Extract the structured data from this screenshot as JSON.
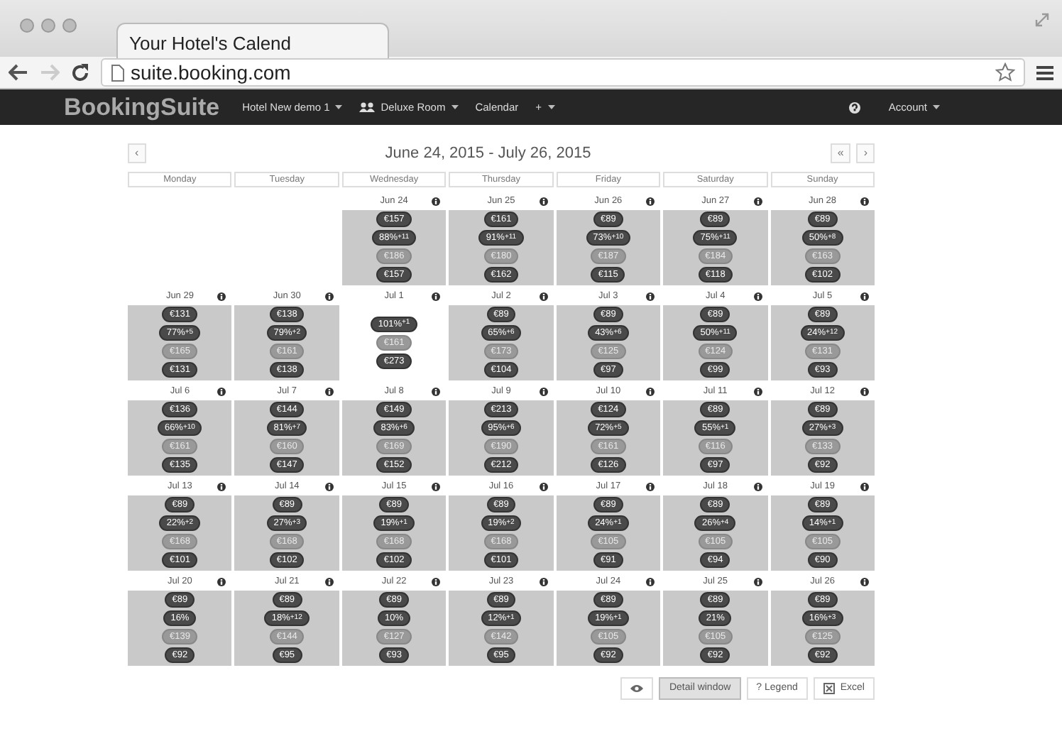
{
  "browser": {
    "tab_title": "Your Hotel's Calend",
    "url": "suite.booking.com"
  },
  "navbar": {
    "brand": "Booking**Suite**",
    "items": [
      {
        "label": "Hotel New demo 1",
        "kind": "plain",
        "dropdown": true
      },
      {
        "label": "Deluxe Room",
        "kind": "room",
        "dropdown": true
      },
      {
        "label": "Calendar",
        "kind": "plain",
        "dropdown": false
      },
      {
        "label": "+",
        "kind": "plain",
        "dropdown": true
      }
    ],
    "account": {
      "label": "Account",
      "dropdown": true
    }
  },
  "calendar": {
    "range": "June 24, 2015 - July 26, 2015",
    "prev": "‹",
    "next": [
      "«",
      "›"
    ],
    "weekdays": [
      "Monday",
      "Tuesday",
      "Wednesday",
      "Thursday",
      "Friday",
      "Saturday",
      "Sunday"
    ],
    "weeks": [
      [
        {
          "kind": "blank"
        },
        {
          "kind": "blank"
        },
        {
          "kind": "day",
          "date": "Jun 24",
          "shaded": true,
          "badges": [
            {
              "text": "€157",
              "muted": false
            },
            {
              "text": "88%$^{+11}$",
              "muted": false
            },
            {
              "text": "€186",
              "muted": true
            },
            {
              "text": "€157",
              "muted": false
            }
          ]
        },
        {
          "kind": "day",
          "date": "Jun 25",
          "shaded": true,
          "badges": [
            {
              "text": "€161",
              "muted": false
            },
            {
              "text": "91%$^{+11}$",
              "muted": false
            },
            {
              "text": "€180",
              "muted": true
            },
            {
              "text": "€162",
              "muted": false
            }
          ]
        },
        {
          "kind": "day",
          "date": "Jun 26",
          "shaded": true,
          "badges": [
            {
              "text": "€89",
              "muted": false
            },
            {
              "text": "73%$^{+10}$",
              "muted": false
            },
            {
              "text": "€187",
              "muted": true
            },
            {
              "text": "€115",
              "muted": false
            }
          ]
        },
        {
          "kind": "day",
          "date": "Jun 27",
          "shaded": true,
          "badges": [
            {
              "text": "€89",
              "muted": false
            },
            {
              "text": "75%$^{+11}$",
              "muted": false
            },
            {
              "text": "€184",
              "muted": true
            },
            {
              "text": "€118",
              "muted": false
            }
          ]
        },
        {
          "kind": "day",
          "date": "Jun 28",
          "shaded": true,
          "badges": [
            {
              "text": "€89",
              "muted": false
            },
            {
              "text": "50%$^{+8}$",
              "muted": false
            },
            {
              "text": "€163",
              "muted": true
            },
            {
              "text": "€102",
              "muted": false
            }
          ]
        }
      ],
      [
        {
          "kind": "day",
          "date": "Jun 29",
          "shaded": true,
          "badges": [
            {
              "text": "€131",
              "muted": false
            },
            {
              "text": "77%$^{+5}$",
              "muted": false
            },
            {
              "text": "€165",
              "muted": true
            },
            {
              "text": "€131",
              "muted": false
            }
          ]
        },
        {
          "kind": "day",
          "date": "Jun 30",
          "shaded": true,
          "badges": [
            {
              "text": "€138",
              "muted": false
            },
            {
              "text": "79%$^{+2}$",
              "muted": false
            },
            {
              "text": "€161",
              "muted": true
            },
            {
              "text": "€138",
              "muted": false
            }
          ]
        },
        {
          "kind": "day",
          "date": "Jul 1",
          "shaded": false,
          "badges": [
            {
              "text": "101%$^{+1}$",
              "muted": false
            },
            {
              "text": "€161",
              "muted": true
            },
            {
              "text": "€273",
              "muted": false
            }
          ]
        },
        {
          "kind": "day",
          "date": "Jul 2",
          "shaded": true,
          "badges": [
            {
              "text": "€89",
              "muted": false
            },
            {
              "text": "65%$^{+6}$",
              "muted": false
            },
            {
              "text": "€173",
              "muted": true
            },
            {
              "text": "€104",
              "muted": false
            }
          ]
        },
        {
          "kind": "day",
          "date": "Jul 3",
          "shaded": true,
          "badges": [
            {
              "text": "€89",
              "muted": false
            },
            {
              "text": "43%$^{+6}$",
              "muted": false
            },
            {
              "text": "€125",
              "muted": true
            },
            {
              "text": "€97",
              "muted": false
            }
          ]
        },
        {
          "kind": "day",
          "date": "Jul 4",
          "shaded": true,
          "badges": [
            {
              "text": "€89",
              "muted": false
            },
            {
              "text": "50%$^{+11}$",
              "muted": false
            },
            {
              "text": "€124",
              "muted": true
            },
            {
              "text": "€99",
              "muted": false
            }
          ]
        },
        {
          "kind": "day",
          "date": "Jul 5",
          "shaded": true,
          "badges": [
            {
              "text": "€89",
              "muted": false
            },
            {
              "text": "24%$^{+12}$",
              "muted": false
            },
            {
              "text": "€131",
              "muted": true
            },
            {
              "text": "€93",
              "muted": false
            }
          ]
        }
      ],
      [
        {
          "kind": "day",
          "date": "Jul 6",
          "shaded": true,
          "badges": [
            {
              "text": "€136",
              "muted": false
            },
            {
              "text": "66%$^{+10}$",
              "muted": false
            },
            {
              "text": "€161",
              "muted": true
            },
            {
              "text": "€135",
              "muted": false
            }
          ]
        },
        {
          "kind": "day",
          "date": "Jul 7",
          "shaded": true,
          "badges": [
            {
              "text": "€144",
              "muted": false
            },
            {
              "text": "81%$^{+7}$",
              "muted": false
            },
            {
              "text": "€160",
              "muted": true
            },
            {
              "text": "€147",
              "muted": false
            }
          ]
        },
        {
          "kind": "day",
          "date": "Jul 8",
          "shaded": true,
          "badges": [
            {
              "text": "€149",
              "muted": false
            },
            {
              "text": "83%$^{+6}$",
              "muted": false
            },
            {
              "text": "€169",
              "muted": true
            },
            {
              "text": "€152",
              "muted": false
            }
          ]
        },
        {
          "kind": "day",
          "date": "Jul 9",
          "shaded": true,
          "badges": [
            {
              "text": "€213",
              "muted": false
            },
            {
              "text": "95%$^{+6}$",
              "muted": false
            },
            {
              "text": "€190",
              "muted": true
            },
            {
              "text": "€212",
              "muted": false
            }
          ]
        },
        {
          "kind": "day",
          "date": "Jul 10",
          "shaded": true,
          "badges": [
            {
              "text": "€124",
              "muted": false
            },
            {
              "text": "72%$^{+5}$",
              "muted": false
            },
            {
              "text": "€161",
              "muted": true
            },
            {
              "text": "€126",
              "muted": false
            }
          ]
        },
        {
          "kind": "day",
          "date": "Jul 11",
          "shaded": true,
          "badges": [
            {
              "text": "€89",
              "muted": false
            },
            {
              "text": "55%$^{+1}$",
              "muted": false
            },
            {
              "text": "€116",
              "muted": true
            },
            {
              "text": "€97",
              "muted": false
            }
          ]
        },
        {
          "kind": "day",
          "date": "Jul 12",
          "shaded": true,
          "badges": [
            {
              "text": "€89",
              "muted": false
            },
            {
              "text": "27%$^{+3}$",
              "muted": false
            },
            {
              "text": "€133",
              "muted": true
            },
            {
              "text": "€92",
              "muted": false
            }
          ]
        }
      ],
      [
        {
          "kind": "day",
          "date": "Jul 13",
          "shaded": true,
          "badges": [
            {
              "text": "€89",
              "muted": false
            },
            {
              "text": "22%$^{+2}$",
              "muted": false
            },
            {
              "text": "€168",
              "muted": true
            },
            {
              "text": "€101",
              "muted": false
            }
          ]
        },
        {
          "kind": "day",
          "date": "Jul 14",
          "shaded": true,
          "badges": [
            {
              "text": "€89",
              "muted": false
            },
            {
              "text": "27%$^{+3}$",
              "muted": false
            },
            {
              "text": "€168",
              "muted": true
            },
            {
              "text": "€102",
              "muted": false
            }
          ]
        },
        {
          "kind": "day",
          "date": "Jul 15",
          "shaded": true,
          "badges": [
            {
              "text": "€89",
              "muted": false
            },
            {
              "text": "19%$^{+1}$",
              "muted": false
            },
            {
              "text": "€168",
              "muted": true
            },
            {
              "text": "€102",
              "muted": false
            }
          ]
        },
        {
          "kind": "day",
          "date": "Jul 16",
          "shaded": true,
          "badges": [
            {
              "text": "€89",
              "muted": false
            },
            {
              "text": "19%$^{+2}$",
              "muted": false
            },
            {
              "text": "€168",
              "muted": true
            },
            {
              "text": "€101",
              "muted": false
            }
          ]
        },
        {
          "kind": "day",
          "date": "Jul 17",
          "shaded": true,
          "badges": [
            {
              "text": "€89",
              "muted": false
            },
            {
              "text": "24%$^{+1}$",
              "muted": false
            },
            {
              "text": "€105",
              "muted": true
            },
            {
              "text": "€91",
              "muted": false
            }
          ]
        },
        {
          "kind": "day",
          "date": "Jul 18",
          "shaded": true,
          "badges": [
            {
              "text": "€89",
              "muted": false
            },
            {
              "text": "26%$^{+4}$",
              "muted": false
            },
            {
              "text": "€105",
              "muted": true
            },
            {
              "text": "€94",
              "muted": false
            }
          ]
        },
        {
          "kind": "day",
          "date": "Jul 19",
          "shaded": true,
          "badges": [
            {
              "text": "€89",
              "muted": false
            },
            {
              "text": "14%$^{+1}$",
              "muted": false
            },
            {
              "text": "€105",
              "muted": true
            },
            {
              "text": "€90",
              "muted": false
            }
          ]
        }
      ],
      [
        {
          "kind": "day",
          "date": "Jul 20",
          "shaded": true,
          "badges": [
            {
              "text": "€89",
              "muted": false
            },
            {
              "text": "16%",
              "muted": false
            },
            {
              "text": "€139",
              "muted": true
            },
            {
              "text": "€92",
              "muted": false
            }
          ]
        },
        {
          "kind": "day",
          "date": "Jul 21",
          "shaded": true,
          "badges": [
            {
              "text": "€89",
              "muted": false
            },
            {
              "text": "18%$^{+12}$",
              "muted": false
            },
            {
              "text": "€144",
              "muted": true
            },
            {
              "text": "€95",
              "muted": false
            }
          ]
        },
        {
          "kind": "day",
          "date": "Jul 22",
          "shaded": true,
          "badges": [
            {
              "text": "€89",
              "muted": false
            },
            {
              "text": "10%",
              "muted": false
            },
            {
              "text": "€127",
              "muted": true
            },
            {
              "text": "€93",
              "muted": false
            }
          ]
        },
        {
          "kind": "day",
          "date": "Jul 23",
          "shaded": true,
          "badges": [
            {
              "text": "€89",
              "muted": false
            },
            {
              "text": "12%$^{+1}$",
              "muted": false
            },
            {
              "text": "€142",
              "muted": true
            },
            {
              "text": "€95",
              "muted": false
            }
          ]
        },
        {
          "kind": "day",
          "date": "Jul 24",
          "shaded": true,
          "badges": [
            {
              "text": "€89",
              "muted": false
            },
            {
              "text": "19%$^{+1}$",
              "muted": false
            },
            {
              "text": "€105",
              "muted": true
            },
            {
              "text": "€92",
              "muted": false
            }
          ]
        },
        {
          "kind": "day",
          "date": "Jul 25",
          "shaded": true,
          "badges": [
            {
              "text": "€89",
              "muted": false
            },
            {
              "text": "21%",
              "muted": false
            },
            {
              "text": "€105",
              "muted": true
            },
            {
              "text": "€92",
              "muted": false
            }
          ]
        },
        {
          "kind": "day",
          "date": "Jul 26",
          "shaded": true,
          "badges": [
            {
              "text": "€89",
              "muted": false
            },
            {
              "text": "16%$^{+3}$",
              "muted": false
            },
            {
              "text": "€125",
              "muted": true
            },
            {
              "text": "€92",
              "muted": false
            }
          ]
        }
      ]
    ]
  },
  "footer": {
    "buttons": [
      {
        "kind": "eye",
        "selected": false
      },
      {
        "kind": "text",
        "label": "Detail window",
        "selected": true
      },
      {
        "kind": "text",
        "label": "? Legend",
        "selected": false
      },
      {
        "kind": "excel",
        "label": "Excel",
        "selected": false
      }
    ]
  }
}
